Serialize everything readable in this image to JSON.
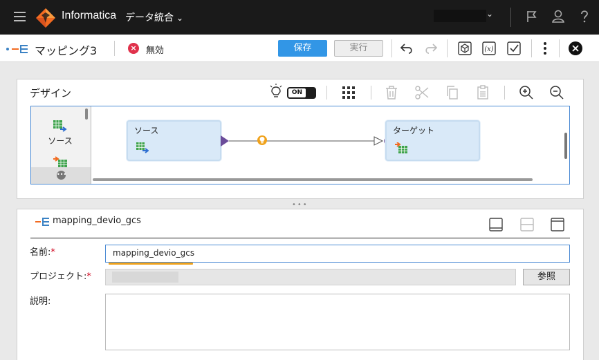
{
  "topbar": {
    "brand": "Informatica",
    "product": "データ統合",
    "product_chevron": "⌄",
    "user_chevron": "⌄"
  },
  "toolbar": {
    "mapping_title": "マッピング3",
    "status": "無効",
    "status_symbol": "×",
    "save_label": "保存",
    "run_label": "実行"
  },
  "design": {
    "title": "デザイン",
    "toggle_label": "ON",
    "palette_label": "ソース",
    "palette_more": "•••",
    "nodes": {
      "source": "ソース",
      "target": "ターゲット"
    }
  },
  "properties": {
    "title": "mapping_devio_gcs",
    "name_label": "名前:",
    "required_mark": "*",
    "name_value": "mapping_devio_gcs",
    "project_label": "プロジェクト:",
    "browse_label": "参照",
    "description_label": "説明:",
    "resize_handle": "•••"
  },
  "colors": {
    "accent_blue": "#3296e6",
    "error_red": "#e0314b",
    "node_fill": "#d9e9f8",
    "link_purple": "#6b4c9a",
    "warning_orange": "#f0a21b"
  }
}
